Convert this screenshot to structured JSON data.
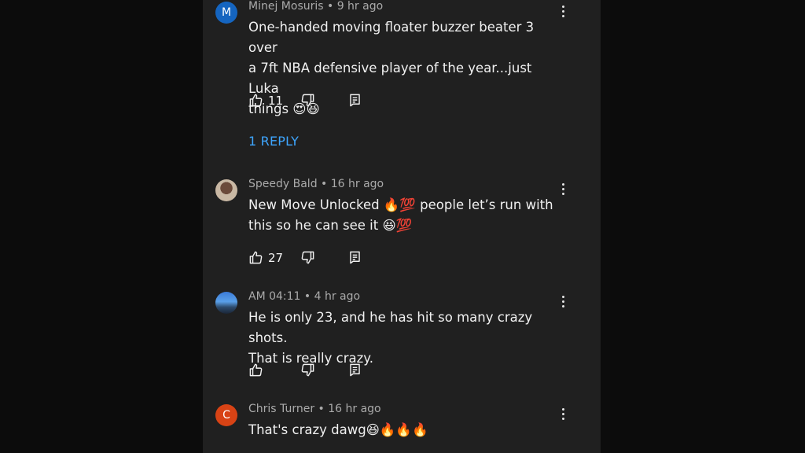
{
  "comments": [
    {
      "avatar_letter": "M",
      "avatar_color": "#1565c0",
      "meta": "Minej Mosuris • 9 hr ago",
      "lines": [
        "One-handed moving floater buzzer beater 3 over",
        "a 7ft NBA defensive player of the year...just Luka",
        "things 😍😆"
      ],
      "likes": "11",
      "reply_link": "1 REPLY"
    },
    {
      "avatar_letter": "",
      "avatar_color": "#c9b8a4",
      "meta": "Speedy Bald • 16 hr ago",
      "lines": [
        "New Move Unlocked 🔥💯 people let’s run with",
        "this so he can see it 😆💯"
      ],
      "likes": "27"
    },
    {
      "avatar_letter": "",
      "avatar_color": "#3b7bd8",
      "meta": "AM 04:11 • 4 hr ago",
      "lines": [
        "He is only 23, and he has hit so many crazy shots.",
        "That is really crazy."
      ],
      "likes": ""
    },
    {
      "avatar_letter": "C",
      "avatar_color": "#d84315",
      "meta": "Chris Turner • 16 hr ago",
      "lines": [
        "That's crazy dawg😆🔥🔥🔥"
      ]
    }
  ],
  "icons": {
    "like": "thumb-up-icon",
    "dislike": "thumb-down-icon",
    "reply": "reply-comment-icon",
    "more": "more-vert-icon"
  }
}
